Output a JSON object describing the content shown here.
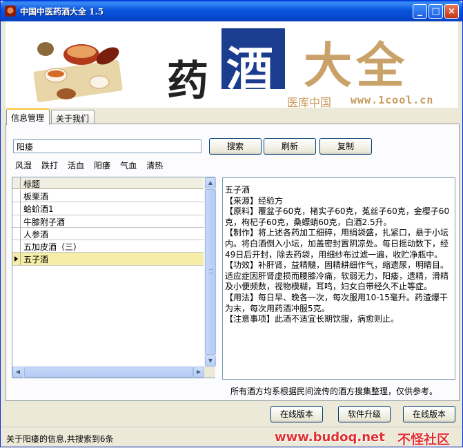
{
  "window": {
    "title": "中国中医药酒大全 1.5"
  },
  "banner": {
    "char_yao": "药",
    "char_jiu": "酒",
    "char_daquan": "大全",
    "subtitle": "医库中国",
    "url": "www.1cool.cn"
  },
  "tabs": [
    {
      "label": "信息管理",
      "active": true
    },
    {
      "label": "关于我们",
      "active": false
    }
  ],
  "search": {
    "value": "阳痿"
  },
  "buttons": {
    "search": "搜索",
    "refresh": "刷新",
    "copy": "复制",
    "online_version_1": "在线版本",
    "upgrade": "软件升级",
    "online_version_2": "在线版本"
  },
  "categories": [
    "风湿",
    "跌打",
    "活血",
    "阳痿",
    "气血",
    "清热"
  ],
  "grid": {
    "header": "标题",
    "rows": [
      "板栗酒",
      "蛤蚧酒1",
      "牛膝附子酒",
      "人参酒",
      "五加皮酒（三）",
      "五子酒"
    ],
    "selected_index": 5
  },
  "detail": {
    "lines": [
      "五子酒",
      "【来源】经验方",
      "【原料】覆盆子60克，楮实子60克，菟丝子60克，金樱子60克，枸杞子60克，桑螵蛸60克，白酒2.5升。",
      "【制作】将上述各药加工细碎，用绢袋盛，扎紧口，悬于小坛内。将白酒倒入小坛，加盖密封置阴凉处。每日摇动数下，经49日后开封，除去药袋，用细纱布过滤一遍，收贮净瓶中。",
      "【功效】补肝肾，益精髓，固精耕细作气，缩遗尿，明睛目。适应症因肝肾虚损而腰膝冷痛，软弱无力，阳痿，遗精，滑精及小便频数，视物模糊，耳鸣，妇女白带经久不止等症。",
      "【用法】每日早、晚各一次，每次服用10-15毫升。药渣爆干为末，每次用药酒冲服5克。",
      "【注意事项】此酒不适宜长期饮服，病愈则止。"
    ]
  },
  "disclaimer": "所有酒方均系根据民间流传的酒方搜集整理，仅供参考。",
  "status": {
    "text": "关于阳痿的信息,共搜索到6条",
    "watermark_url": "www.budoq.net",
    "watermark_name": "不怪社区"
  },
  "colors": {
    "titlebar": "#0855dd",
    "selected_row": "#f6eea8",
    "banner_gold": "#c9a26a",
    "banner_blue": "#1b3d8f",
    "watermark": "#e03030"
  }
}
